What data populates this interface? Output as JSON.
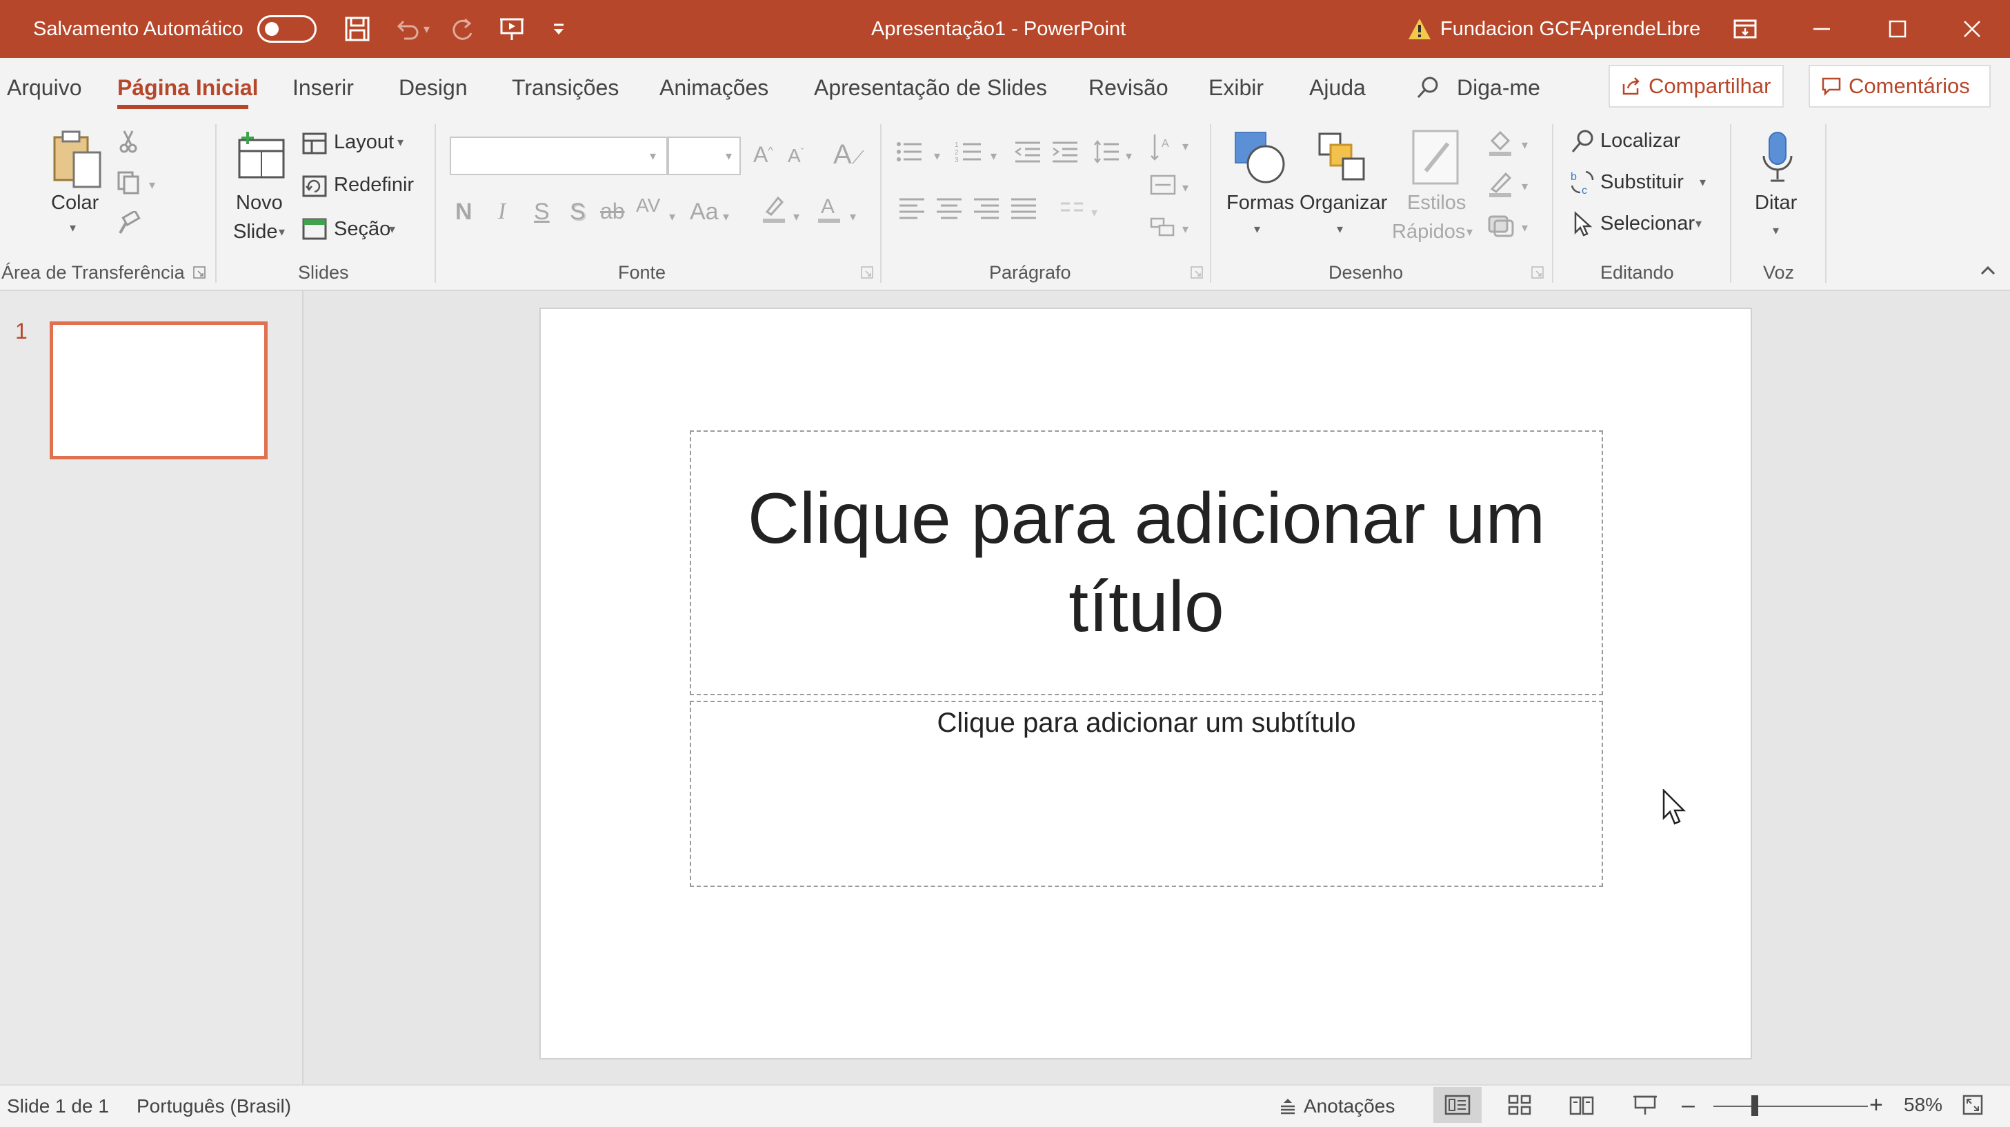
{
  "titlebar": {
    "autosave_label": "Salvamento Automático",
    "document_title": "Apresentação1  -  PowerPoint",
    "account_name": "Fundacion GCFAprendeLibre",
    "icons": [
      "save-icon",
      "undo-icon",
      "redo-icon",
      "present-from-start-icon",
      "customize-quick-access-icon",
      "warning-icon",
      "ribbon-display-options-icon",
      "minimize-icon",
      "maximize-icon",
      "close-icon"
    ]
  },
  "menu": {
    "tabs": [
      "Arquivo",
      "Página Inicial",
      "Inserir",
      "Design",
      "Transições",
      "Animações",
      "Apresentação de Slides",
      "Revisão",
      "Exibir",
      "Ajuda"
    ],
    "active_tab": "Página Inicial",
    "tell_me": "Diga-me",
    "share": "Compartilhar",
    "comments": "Comentários"
  },
  "ribbon": {
    "clipboard": {
      "paste": "Colar",
      "group": "Área de Transferência"
    },
    "slides": {
      "new_slide_line1": "Novo",
      "new_slide_line2": "Slide",
      "layout": "Layout",
      "reset": "Redefinir",
      "section": "Seção",
      "group": "Slides"
    },
    "font": {
      "bold": "N",
      "italic": "I",
      "underline": "S",
      "shadow": "S",
      "spacing": "AV",
      "case": "Aa",
      "group": "Fonte"
    },
    "paragraph": {
      "group": "Parágrafo"
    },
    "drawing": {
      "shapes": "Formas",
      "arrange": "Organizar",
      "quick_styles_line1": "Estilos",
      "quick_styles_line2": "Rápidos",
      "group": "Desenho"
    },
    "editing": {
      "find": "Localizar",
      "replace": "Substituir",
      "select": "Selecionar",
      "group": "Editando"
    },
    "voice": {
      "dictate": "Ditar",
      "group": "Voz"
    }
  },
  "thumbnails": {
    "slide_number": "1"
  },
  "slide": {
    "title_line1": "Clique para adicionar um",
    "title_line2": "título",
    "subtitle_placeholder": "Clique para adicionar um subtítulo"
  },
  "status": {
    "slide_info": "Slide 1 de 1",
    "language": "Português (Brasil)",
    "notes": "Anotações",
    "zoom": "58%",
    "zoom_fraction": 0.58
  },
  "colors": {
    "accent": "#b7472a",
    "thumb_border": "#e0704e"
  }
}
